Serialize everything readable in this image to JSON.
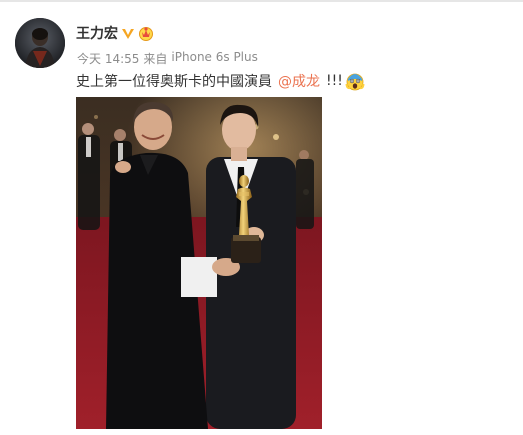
{
  "post": {
    "author_name": "王力宏",
    "time": "今天 14:55",
    "source_prefix": "来自",
    "source_device": "iPhone 6s Plus",
    "text": "史上第一位得奥斯卡的中國演員",
    "mention": "@成龙",
    "exclaim": "!!!"
  },
  "icons": {
    "verified": "verified-badge-icon",
    "vip": "vip-crown-icon",
    "emoji": "shocked-face-emoji-icon"
  },
  "colors": {
    "mention": "#eb7350",
    "meta_text": "#8c8c8c",
    "verified": "#f5a623",
    "carpet": "#8a1620"
  }
}
